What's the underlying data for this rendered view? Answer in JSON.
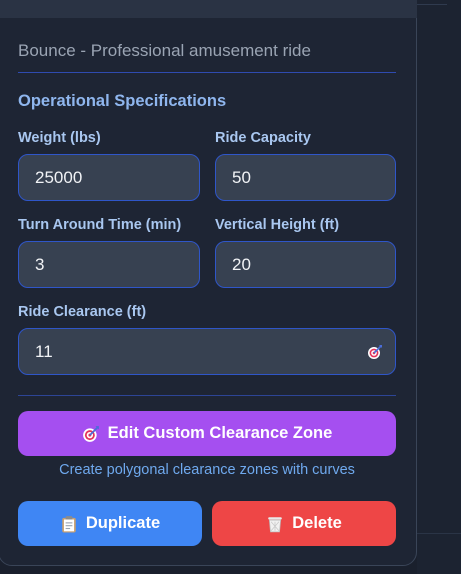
{
  "ride": {
    "subtitle": "Bounce - Professional amusement ride"
  },
  "specs": {
    "section_title": "Operational Specifications",
    "weight_label": "Weight (lbs)",
    "weight_value": "25000",
    "capacity_label": "Ride Capacity",
    "capacity_value": "50",
    "turnaround_label": "Turn Around Time (min)",
    "turnaround_value": "3",
    "height_label": "Vertical Height (ft)",
    "height_value": "20",
    "clearance_label": "Ride Clearance (ft)",
    "clearance_value": "11"
  },
  "actions": {
    "edit_zone_label": "Edit Custom Clearance Zone",
    "edit_zone_hint": "Create polygonal clearance zones with curves",
    "duplicate_label": "Duplicate",
    "delete_label": "Delete"
  },
  "colors": {
    "accent_purple": "#a54ff0",
    "accent_blue": "#3f86f4",
    "accent_red": "#ee4646",
    "field_border": "#2f56c9"
  },
  "icons": {
    "clearance_field": "target-icon",
    "edit_zone": "target-icon",
    "duplicate": "clipboard-icon",
    "delete": "trash-icon"
  }
}
